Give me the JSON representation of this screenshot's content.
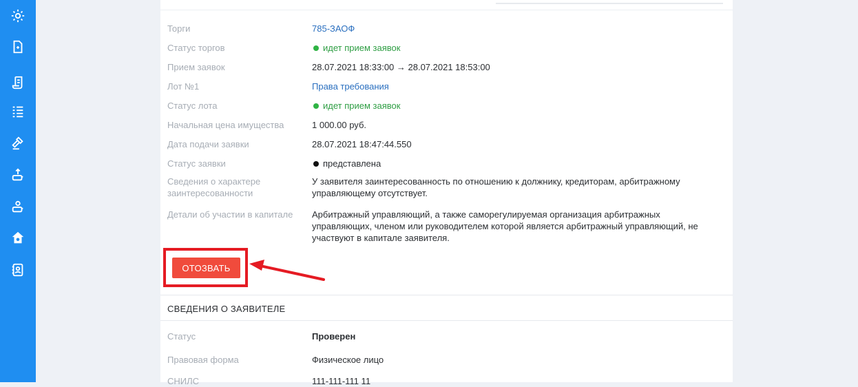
{
  "sidebar": {
    "icons": [
      "gear-icon",
      "document-icon",
      "scroll-icon",
      "list-icon",
      "gavel-icon",
      "upload-icon",
      "user-transfer-icon",
      "home-icon",
      "contacts-icon"
    ]
  },
  "auction": {
    "rows": [
      {
        "label": "Торги",
        "value": "785-ЗАОФ",
        "style": "link"
      },
      {
        "label": "Статус торгов",
        "value": "идет прием заявок",
        "style": "green"
      },
      {
        "label": "Прием заявок",
        "value": "28.07.2021 18:33:00 → 28.07.2021 18:53:00",
        "style": "plain"
      },
      {
        "label": "Лот №1",
        "value": "Права требования",
        "style": "link"
      },
      {
        "label": "Статус лота",
        "value": "идет прием заявок",
        "style": "green"
      },
      {
        "label": "Начальная цена имущества",
        "value": "1 000.00 руб.",
        "style": "plain"
      },
      {
        "label": "Дата подачи заявки",
        "value": "28.07.2021 18:47:44.550",
        "style": "plain"
      },
      {
        "label": "Статус заявки",
        "value": "представлена",
        "style": "black-dot"
      },
      {
        "label": "Сведения о характере заинтересованности",
        "value": "У заявителя заинтересованность по отношению к должнику, кредиторам, арбитражному управляющему отсутствует.",
        "style": "plain"
      },
      {
        "label": "Детали об участии в капитале",
        "value": "Арбитражный управляющий, а также саморегулируемая организация арбитражных управляющих, членом или руководителем которой является арбитражный управляющий, не участвуют в капитале заявителя.",
        "style": "plain"
      }
    ]
  },
  "actions": {
    "withdraw_label": "ОТОЗВАТЬ"
  },
  "applicant": {
    "section_title": "СВЕДЕНИЯ О ЗАЯВИТЕЛЕ",
    "rows": [
      {
        "label": "Статус",
        "value": "Проверен",
        "style": "bold"
      },
      {
        "label": "Правовая форма",
        "value": "Физическое лицо",
        "style": "plain"
      },
      {
        "label": "СНИЛС",
        "value": "111-111-111 11",
        "style": "plain"
      }
    ]
  },
  "colors": {
    "sidebar": "#1f8ef1",
    "withdraw": "#f04b3c",
    "highlight": "#e51b23",
    "link": "#2a6fbf",
    "status_green": "#2fb344"
  }
}
